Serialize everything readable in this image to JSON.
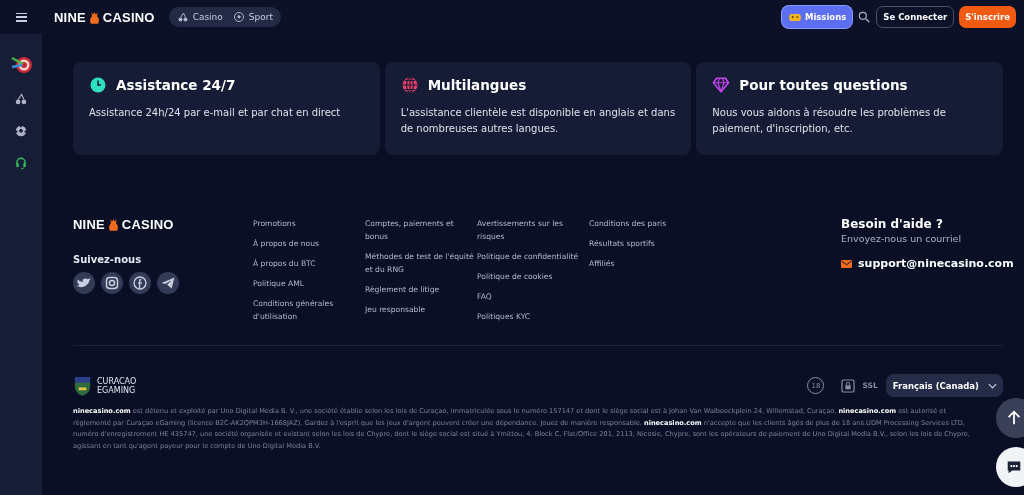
{
  "header": {
    "logo": {
      "left": "NINE",
      "right": "CASINO"
    },
    "nav": [
      {
        "kind": "cherry",
        "label": "Casino"
      },
      {
        "kind": "ball",
        "label": "Sport"
      }
    ],
    "buttons": [
      {
        "kind": "missions",
        "label": "Missions"
      },
      {
        "kind": "outline",
        "label": "Se Connecter"
      },
      {
        "kind": "primary",
        "label": "S'inscrire"
      }
    ]
  },
  "cards": [
    {
      "kind": "clock",
      "title": "Assistance 24/7",
      "text": "Assistance 24h/24 par e-mail et par chat en direct"
    },
    {
      "kind": "globe",
      "title": "Multilangues",
      "text": "L'assistance clientèle est disponible en anglais et dans de nombreuses autres langues."
    },
    {
      "kind": "diamond",
      "title": "Pour toutes questions",
      "text": "Nous vous aidons à résoudre les problèmes de paiement, d'inscription, etc."
    }
  ],
  "footer": {
    "logo": {
      "left": "NINE",
      "right": "CASINO"
    },
    "follow_title": "Suivez-nous",
    "socials": [
      {
        "kind": "twitter"
      },
      {
        "kind": "instagram"
      },
      {
        "kind": "facebook"
      },
      {
        "kind": "telegram"
      }
    ],
    "columns": [
      [
        "Promotions",
        "À propos de nous",
        "À propos du BTC",
        "Politique AML",
        "Conditions générales d'utilisation"
      ],
      [
        "Comptes, paiements et bonus",
        "Méthodes de test de l'équité et du RNG",
        "Règlement de litige",
        "Jeu responsable"
      ],
      [
        "Avertissements sur les risques",
        "Politique de confidentialité",
        "Politique de cookies",
        "FAQ",
        "Politiques KYC"
      ],
      [
        "Conditions des paris",
        "Résultats sportifs",
        "Affiliés"
      ]
    ],
    "help": {
      "title": "Besoin d'aide ?",
      "subtitle": "Envoyez-nous un courriel",
      "email": "support@ninecasino.com"
    },
    "license": {
      "line1": "CURACAO",
      "line2": "EGAMING"
    },
    "badges": [
      {
        "kind": "age",
        "label": "18"
      },
      {
        "kind": "ssl",
        "label": "SSL"
      }
    ],
    "language": "Français (Canada)",
    "legal": "**ninecasino.com** est détenu et exploité par Uno Digital Media B. V., une société établie selon les lois de Curaçao, immatriculée sous le numéro 157147 et dont le siège social est à Johan Van Walbeeckplein 24, Willemstad, Curaçao. **ninecasino.com** est autorisé et réglementé par Curaçao eGaming (licence B2C-AK2QPM3H-1668JAZ). Gardez à l'esprit que les jeux d'argent peuvent créer une dépendance. Jouez de manière responsable. **ninecasino.com** n'accepte que les clients âgés de plus de 18 ans.UDM Processing Services LTD, numéro d'enregistrement HE 435747, une société organisée et existant selon les lois de Chypre, dont le siège social est situé à Ymittou, 4. Block C, Flat/Office 201, 2113, Nicosie, Chypre, sont les opérateurs de paiement de Uno Digital Media B.V., selon les lois de Chypre, agissant en tant qu'agent payeur pour le compte de Uno Digital Media B.V."
  }
}
